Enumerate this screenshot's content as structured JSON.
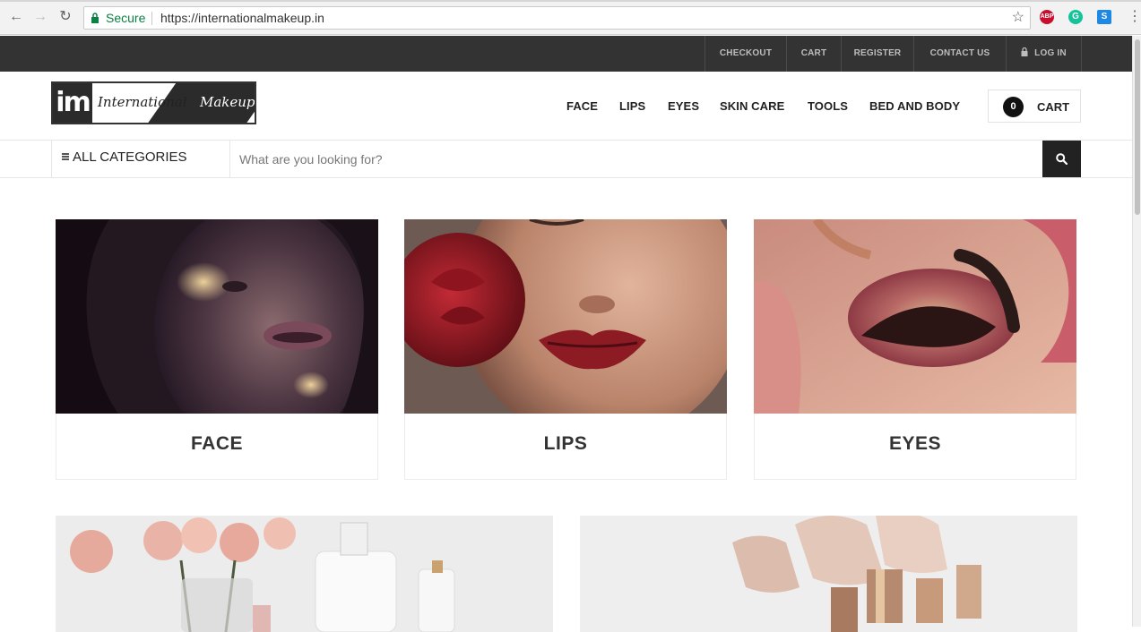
{
  "browser": {
    "secure_label": "Secure",
    "url": "https://internationalmakeup.in",
    "extensions": [
      "ABP",
      "G",
      "S"
    ]
  },
  "topbar": {
    "links": [
      "CHECKOUT",
      "CART",
      "REGISTER",
      "CONTACT US"
    ],
    "login": "LOG IN"
  },
  "logo": {
    "mark": "im",
    "word1": "International",
    "word2": "Makeup"
  },
  "nav": {
    "items": [
      "FACE",
      "LIPS",
      "EYES",
      "SKIN CARE",
      "TOOLS",
      "BED AND BODY"
    ],
    "cart_count": "0",
    "cart_label": "CART"
  },
  "search": {
    "categories_label": "ALL CATEGORIES",
    "placeholder": "What are you looking for?"
  },
  "categories": [
    {
      "title": "FACE"
    },
    {
      "title": "LIPS"
    },
    {
      "title": "EYES"
    }
  ],
  "colors": {
    "topbar_bg": "#333333",
    "secure_green": "#0b8043",
    "search_button": "#222222"
  }
}
